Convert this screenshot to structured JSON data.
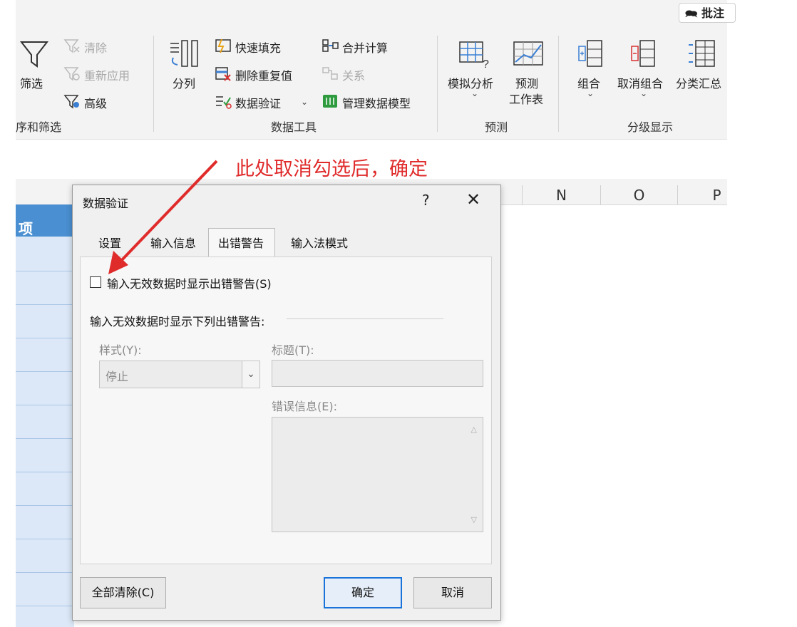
{
  "ribbon": {
    "comment_button": "批注",
    "sort_filter": {
      "filter": "筛选",
      "clear": "清除",
      "reapply": "重新应用",
      "advanced": "高级",
      "group_label": "序和筛选"
    },
    "data_tools": {
      "text_to_columns": "分列",
      "flash_fill": "快速填充",
      "remove_duplicates": "删除重复值",
      "data_validation": "数据验证",
      "consolidate": "合并计算",
      "relationships": "关系",
      "manage_data_model": "管理数据模型",
      "group_label": "数据工具"
    },
    "forecast": {
      "what_if": "模拟分析",
      "forecast_sheet_line1": "预测",
      "forecast_sheet_line2": "工作表",
      "group_label": "预测"
    },
    "outline": {
      "group": "组合",
      "ungroup": "取消组合",
      "subtotal": "分类汇总",
      "group_label": "分级显示"
    }
  },
  "sheet": {
    "columns": [
      "N",
      "O",
      "P"
    ],
    "left_header": "项"
  },
  "annotation": "此处取消勾选后，确定",
  "dialog": {
    "title": "数据验证",
    "help": "?",
    "close": "✕",
    "tabs": [
      "设置",
      "输入信息",
      "出错警告",
      "输入法模式"
    ],
    "active_tab": "出错警告",
    "show_error_checkbox": {
      "label": "输入无效数据时显示出错警告(S)",
      "checked": false
    },
    "section_label": "输入无效数据时显示下列出错警告:",
    "style_label": "样式(Y):",
    "style_value": "停止",
    "title_label": "标题(T):",
    "title_value": "",
    "message_label": "错误信息(E):",
    "message_value": "",
    "clear_all": "全部清除(C)",
    "ok": "确定",
    "cancel": "取消"
  }
}
